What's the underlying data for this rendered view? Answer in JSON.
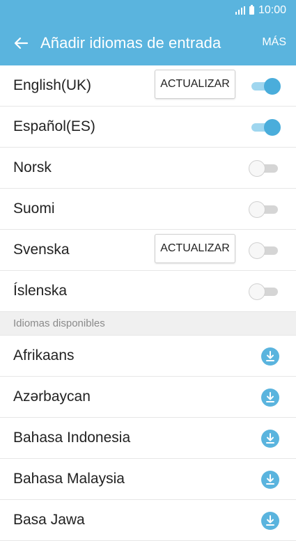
{
  "status": {
    "time": "10:00",
    "icons": [
      "signal-icon",
      "battery-icon"
    ]
  },
  "appbar": {
    "title": "Añadir idiomas de entrada",
    "more": "MÁS",
    "back_icon": "arrow-left-icon",
    "color": "#5ab4de"
  },
  "installed": [
    {
      "label": "English(UK)",
      "update": "ACTUALIZAR",
      "enabled": true
    },
    {
      "label": "Español(ES)",
      "enabled": true
    },
    {
      "label": "Norsk",
      "enabled": false
    },
    {
      "label": "Suomi",
      "enabled": false
    },
    {
      "label": "Svenska",
      "update": "ACTUALIZAR",
      "enabled": false
    },
    {
      "label": "Íslenska",
      "enabled": false
    }
  ],
  "available": {
    "header": "Idiomas disponibles",
    "items": [
      {
        "label": "Afrikaans"
      },
      {
        "label": "Azərbaycan"
      },
      {
        "label": "Bahasa Indonesia"
      },
      {
        "label": "Bahasa Malaysia"
      },
      {
        "label": "Basa Jawa"
      }
    ],
    "download_icon": "download-icon",
    "download_color": "#5ab4de"
  }
}
